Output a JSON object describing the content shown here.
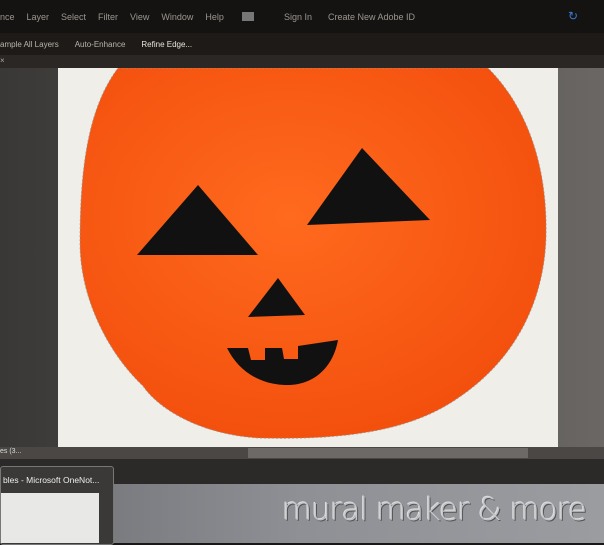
{
  "menubar": {
    "items": [
      "nce",
      "Layer",
      "Select",
      "Filter",
      "View",
      "Window",
      "Help"
    ],
    "sign_in": "Sign In",
    "create_id": "Create New Adobe ID",
    "workspace_icon": "workspace-icon",
    "sync_icon": "sync-icon"
  },
  "options_bar": {
    "sample_all_layers": "ample All Layers",
    "auto_enhance": "Auto-Enhance",
    "refine_edge": "Refine Edge..."
  },
  "status_bar": {
    "doc_info": "es (3..."
  },
  "taskbar": {
    "thumbnail_title": "bles - Microsoft OneNot..."
  },
  "watermark": "mural maker & more",
  "colors": {
    "pumpkin": "#ff5a14",
    "canvas": "#efeee9",
    "features": "#111111"
  }
}
